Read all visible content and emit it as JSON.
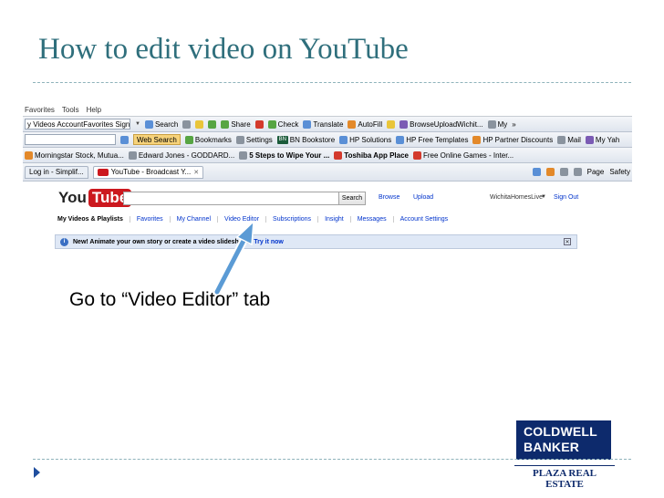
{
  "slide": {
    "title": "How to edit video on YouTube",
    "callout": "Go to “Video Editor” tab"
  },
  "browser": {
    "menubar": [
      "Favorites",
      "Tools",
      "Help"
    ],
    "toolbar1": {
      "address": "y Videos AccountFavorites Sign Out",
      "items": [
        "Search",
        "Share",
        "Check",
        "Translate",
        "AutoFill",
        "BrowseUploadWichit...",
        "My"
      ],
      "overflow": "»"
    },
    "toolbar2": {
      "web_search": "Web Search",
      "items": [
        "Bookmarks",
        "Settings",
        "BN Bookstore",
        "HP Solutions",
        "HP Free Templates",
        "HP Partner Discounts",
        "Mail",
        "My Yah"
      ]
    },
    "toolbar3": {
      "items": [
        "Morningstar Stock, Mutua...",
        "Edward Jones - GODDARD...",
        "5 Steps to Wipe Your ...",
        "Toshiba App Place",
        "Free Online Games - Inter..."
      ]
    },
    "tabs": {
      "items": [
        "Log in - Simplif...",
        "YouTube - Broadcast Y..."
      ],
      "active_index": 1,
      "right_tools": [
        "Page",
        "Safety"
      ]
    }
  },
  "youtube": {
    "logo_you": "You",
    "logo_tube": "Tube",
    "search_button": "Search",
    "links": [
      "Browse",
      "Upload"
    ],
    "user": "WichitaHomesLive",
    "sign_out": "Sign Out",
    "nav": [
      "My Videos & Playlists",
      "Favorites",
      "My Channel",
      "Video Editor",
      "Subscriptions",
      "Insight",
      "Messages",
      "Account Settings"
    ],
    "notice": {
      "bold": "New! Animate your own story or create a video slideshow.",
      "link": "Try it now"
    }
  },
  "logo": {
    "line1": "COLDWELL",
    "line2": "BANKER",
    "sub": "PLAZA REAL ESTATE"
  },
  "colors": {
    "title": "#2f6f7c",
    "arrow": "#5b9bd5",
    "logo": "#0d2a6c",
    "youtube_red": "#cc181e"
  }
}
